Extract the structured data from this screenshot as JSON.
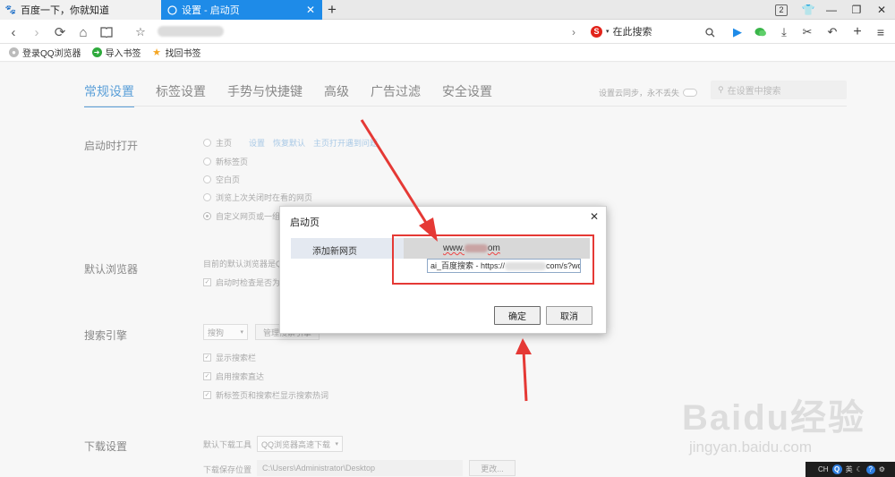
{
  "tabs": [
    {
      "title": "百度一下，你就知道",
      "icon": "baidu-paw-icon",
      "active": false
    },
    {
      "title": "设置 - 启动页",
      "icon": "settings-circle-icon",
      "active": true
    }
  ],
  "window": {
    "tab_count": "2"
  },
  "search": {
    "engine_placeholder": "在此搜索"
  },
  "bookmarks": [
    {
      "label": "登录QQ浏览器",
      "icon": "user-icon"
    },
    {
      "label": "导入书签",
      "icon": "import-icon"
    },
    {
      "label": "找回书签",
      "icon": "star-icon"
    }
  ],
  "settings": {
    "tabs": [
      "常规设置",
      "标签设置",
      "手势与快捷键",
      "高级",
      "广告过滤",
      "安全设置"
    ],
    "sync_text": "设置云同步，永不丢失",
    "search_placeholder": "在设置中搜索",
    "startup": {
      "label": "启动时打开",
      "options": [
        "主页",
        "新标签页",
        "空白页",
        "浏览上次关闭时在看的网页",
        "自定义网页或一组"
      ],
      "home_links": [
        "设置",
        "恢复默认",
        "主页打开遇到问题"
      ]
    },
    "default_browser": {
      "label": "默认浏览器",
      "text": "目前的默认浏览器是QQ",
      "check": "启动时检查是否为"
    },
    "search_engine": {
      "label": "搜索引擎",
      "select": "搜狗",
      "manage": "管理搜索引擎",
      "checks": [
        "显示搜索栏",
        "启用搜索直达",
        "新标签页和搜索栏显示搜索热词"
      ]
    },
    "download": {
      "label": "下载设置",
      "tool_label": "默认下载工具",
      "tool_value": "QQ浏览器高速下载",
      "path_label": "下载保存位置",
      "path_value": "C:\\Users\\Administrator\\Desktop",
      "change": "更改..."
    }
  },
  "dialog": {
    "title": "启动页",
    "row_label": "添加新网页",
    "url_prefix": "www.",
    "url_suffix": "om",
    "input_prefix": "ai_百度搜索 - https://",
    "input_suffix": "com/s?wd",
    "ok": "确定",
    "cancel": "取消"
  },
  "watermark": {
    "main": "Baidu经验",
    "sub": "jingyan.baidu.com"
  },
  "tray": {
    "lang1": "CH",
    "lang2": "英"
  },
  "colors": {
    "accent": "#1e8be8",
    "highlight": "#e53935"
  }
}
